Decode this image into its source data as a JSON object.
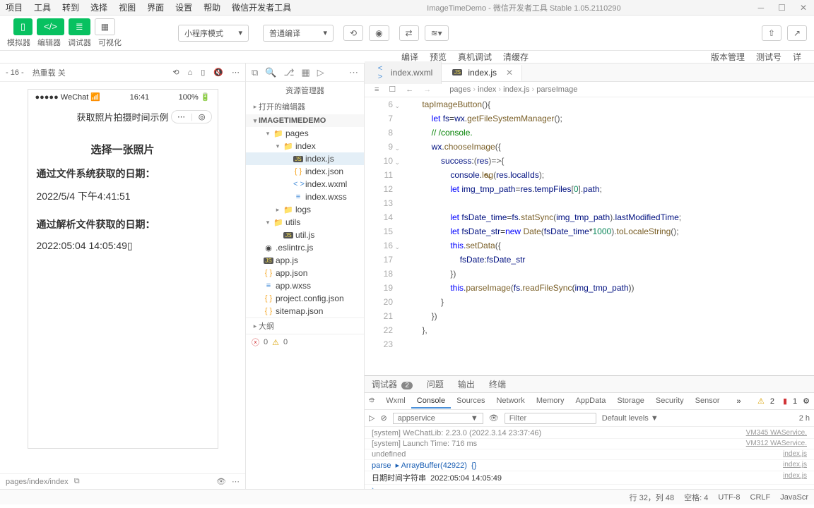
{
  "titlebar": {
    "menus": [
      "项目",
      "工具",
      "转到",
      "选择",
      "视图",
      "界面",
      "设置",
      "帮助",
      "微信开发者工具"
    ],
    "title": "ImageTimeDemo - 微信开发者工具 Stable 1.05.2110290"
  },
  "toolbar": {
    "labels": [
      "模拟器",
      "编辑器",
      "调试器",
      "可视化"
    ],
    "mode_select": "小程序模式",
    "compile_select": "普通编译",
    "actions": [
      "编译",
      "预览",
      "真机调试",
      "清缓存"
    ],
    "right_actions": [
      "版本管理",
      "测试号",
      "详"
    ]
  },
  "sim_bar": {
    "zoom": "- 16 -",
    "hot": "热重载 关"
  },
  "device": {
    "carrier": "●●●●● WeChat",
    "wifi": "⌃",
    "time": "16:41",
    "battery": "100%",
    "battery_icon": "▮",
    "nav_title": "获取照片拍摄时间示例",
    "btn": "选择一张照片",
    "label1": "通过文件系统获取的日期：",
    "val1": "2022/5/4 下午4:41:51",
    "label2": "通过解析文件获取的日期：",
    "val2": "2022:05:04 14:05:49▯"
  },
  "sim_footer": {
    "path": "pages/index/index"
  },
  "explorer": {
    "title": "资源管理器",
    "open_editors": "打开的编辑器",
    "project": "IMAGETIMEDEMO",
    "tree": [
      {
        "indent": 1,
        "twist": "▾",
        "icon": "folder",
        "name": "pages"
      },
      {
        "indent": 2,
        "twist": "▾",
        "icon": "folder",
        "name": "index"
      },
      {
        "indent": 3,
        "twist": "",
        "icon": "js",
        "name": "index.js",
        "selected": true
      },
      {
        "indent": 3,
        "twist": "",
        "icon": "json",
        "name": "index.json"
      },
      {
        "indent": 3,
        "twist": "",
        "icon": "wxml",
        "name": "index.wxml"
      },
      {
        "indent": 3,
        "twist": "",
        "icon": "wxss",
        "name": "index.wxss"
      },
      {
        "indent": 2,
        "twist": "▸",
        "icon": "folder",
        "name": "logs"
      },
      {
        "indent": 1,
        "twist": "▾",
        "icon": "folder",
        "name": "utils"
      },
      {
        "indent": 2,
        "twist": "",
        "icon": "js",
        "name": "util.js"
      },
      {
        "indent": 0,
        "twist": "",
        "icon": "eslint",
        "name": ".eslintrc.js"
      },
      {
        "indent": 0,
        "twist": "",
        "icon": "js",
        "name": "app.js"
      },
      {
        "indent": 0,
        "twist": "",
        "icon": "json",
        "name": "app.json"
      },
      {
        "indent": 0,
        "twist": "",
        "icon": "wxss",
        "name": "app.wxss"
      },
      {
        "indent": 0,
        "twist": "",
        "icon": "json",
        "name": "project.config.json"
      },
      {
        "indent": 0,
        "twist": "",
        "icon": "json",
        "name": "sitemap.json"
      }
    ],
    "outline": "大纲",
    "footer_err": "0",
    "footer_warn": "0"
  },
  "editor": {
    "tabs": [
      {
        "icon": "wxml",
        "name": "index.wxml",
        "active": false
      },
      {
        "icon": "js",
        "name": "index.js",
        "active": true,
        "close": true
      }
    ],
    "breadcrumb": [
      "pages",
      "index",
      "index.js",
      "parseImage"
    ],
    "gutter_start": 6,
    "gutter_end": 23,
    "fold_lines": [
      6,
      9,
      10,
      16
    ],
    "code_lines": [
      {
        "html": "    <span class='tok-fn'>tapImageButton</span><span class='tok-punc'>(){</span>"
      },
      {
        "html": "        <span class='tok-kw'>let</span> <span class='tok-var'>fs</span>=<span class='tok-var'>wx</span>.<span class='tok-fn'>getFileSystemManager</span><span class='tok-punc'>();</span>"
      },
      {
        "html": "        <span class='tok-com'>// /console.</span>"
      },
      {
        "html": "        <span class='tok-var'>wx</span>.<span class='tok-fn'>chooseImage</span><span class='tok-punc'>({</span>"
      },
      {
        "html": "            <span class='tok-prop'>success</span>:<span class='tok-punc'>(</span><span class='tok-var'>res</span><span class='tok-punc'>)=>{</span>"
      },
      {
        "html": "                <span class='tok-var'>console</span>.<span class='tok-fn'>l<span style='position:relative'>o<span style='position:absolute;left:0;top:-2px;font-size:12px'>↖</span></span>g</span><span class='tok-punc'>(</span><span class='tok-var'>res</span>.<span class='tok-prop'>localIds</span><span class='tok-punc'>);</span>"
      },
      {
        "html": "                <span class='tok-kw'>let</span> <span class='tok-var'>img_tmp_path</span>=<span class='tok-var'>res</span>.<span class='tok-prop'>tempFiles</span><span class='tok-punc'>[</span><span class='tok-num'>0</span><span class='tok-punc'>].</span><span class='tok-prop'>path</span><span class='tok-punc'>;</span>"
      },
      {
        "html": ""
      },
      {
        "html": "                <span class='tok-kw'>let</span> <span class='tok-var'>fsDate_time</span>=<span class='tok-var'>fs</span>.<span class='tok-fn'>statSync</span><span class='tok-punc'>(</span><span class='tok-var'>img_tmp_path</span><span class='tok-punc'>).</span><span class='tok-prop'>lastModifiedTime</span><span class='tok-punc'>;</span>"
      },
      {
        "html": "                <span class='tok-kw'>let</span> <span class='tok-var'>fsDate_str</span>=<span class='tok-kw'>new</span> <span class='tok-fn'>Date</span><span class='tok-punc'>(</span><span class='tok-var'>fsDate_time</span>*<span class='tok-num'>1000</span><span class='tok-punc'>).</span><span class='tok-fn'>toLocaleString</span><span class='tok-punc'>();</span>"
      },
      {
        "html": "                <span class='tok-this'>this</span>.<span class='tok-fn'>setData</span><span class='tok-punc'>({</span>"
      },
      {
        "html": "                    <span class='tok-prop'>fsDate</span>:<span class='tok-var'>fsDate_str</span>"
      },
      {
        "html": "                <span class='tok-punc'>})</span>"
      },
      {
        "html": "                <span class='tok-this'>this</span>.<span class='tok-fn'>parseImage</span><span class='tok-punc'>(</span><span class='tok-var'>fs</span>.<span class='tok-fn'>readFileSync</span>(<span class='tok-var'>img_tmp_path</span>)<span class='tok-punc'>)</span>"
      },
      {
        "html": "            <span class='tok-punc'>}</span>"
      },
      {
        "html": "        <span class='tok-punc'>})</span>"
      },
      {
        "html": "    <span class='tok-punc'>},</span>"
      },
      {
        "html": ""
      }
    ]
  },
  "devtools": {
    "top_tabs": [
      {
        "name": "调试器",
        "badge": "2"
      },
      {
        "name": "问题"
      },
      {
        "name": "输出"
      },
      {
        "name": "终端"
      }
    ],
    "sub_tabs": [
      "Wxml",
      "Console",
      "Sources",
      "Network",
      "Memory",
      "AppData",
      "Storage",
      "Security",
      "Sensor"
    ],
    "sub_active": "Console",
    "warn_count": "2",
    "err_count": "1",
    "filter_context": "appservice",
    "filter_placeholder": "Filter",
    "levels": "Default levels ▼",
    "hidden": "2 h",
    "logs": [
      {
        "msg": "[system] WeChatLib: 2.23.0 (2022.3.14 23:37:46)",
        "src": "VM345 WAService.",
        "cls": "sys"
      },
      {
        "msg": "[system] Launch Time: 716 ms",
        "src": "VM312 WAService.",
        "cls": "sys"
      },
      {
        "msg": "undefined",
        "src": "index.js",
        "cls": "sys"
      },
      {
        "msg": "parse  ▸ ArrayBuffer(42922)  {}",
        "src": "index.js",
        "cls": "blue"
      },
      {
        "msg": "日期时间字符串  2022:05:04 14:05:49",
        "src": "index.js",
        "cls": ""
      }
    ]
  },
  "statusbar": {
    "line": "行 32，列 48",
    "spaces": "空格: 4",
    "enc": "UTF-8",
    "eol": "CRLF",
    "lang": "JavaScr"
  }
}
